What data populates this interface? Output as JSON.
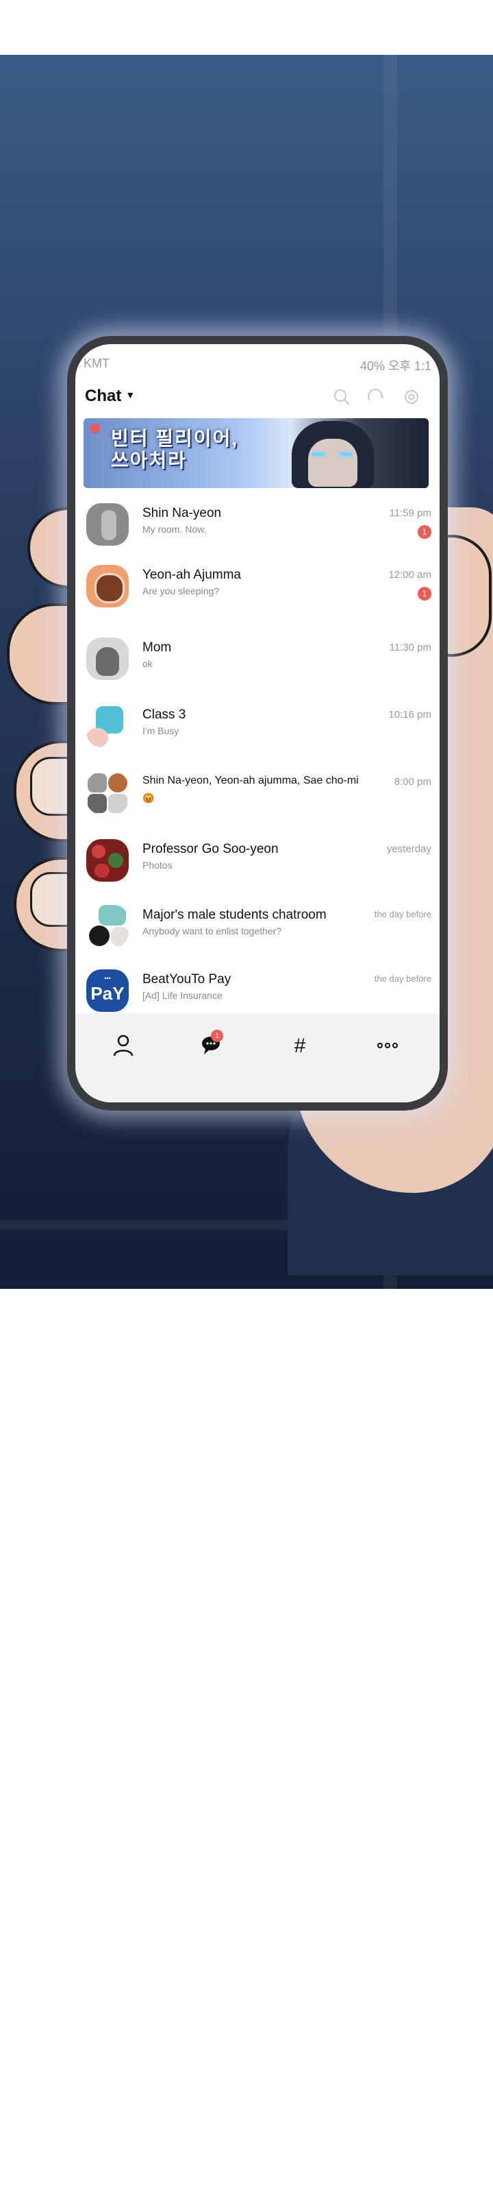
{
  "statusbar": {
    "carrier": "KMT",
    "right": "40% 오후 1:1"
  },
  "header": {
    "title": "Chat"
  },
  "banner": {
    "line1": "빈터 필리이어,",
    "line2": "쓰아처라"
  },
  "chats": [
    {
      "name": "Shin Na-yeon",
      "message": "My room. Now.",
      "time": "11:59 pm",
      "unread": "1"
    },
    {
      "name": "Yeon-ah Ajumma",
      "message": "Are you sleeping?",
      "time": "12:00 am",
      "unread": "1"
    },
    {
      "name": "Mom",
      "message": "ok",
      "time": "11:30 pm",
      "unread": ""
    },
    {
      "name": "Class 3",
      "message": "I'm Busy",
      "time": "10:16 pm",
      "unread": ""
    },
    {
      "name": "Shin Na-yeon, Yeon-ah ajumma, Sae cho-mi",
      "message": "😡",
      "time": "8:00 pm",
      "unread": ""
    },
    {
      "name": "Professor Go Soo-yeon",
      "message": "Photos",
      "time": "yesterday",
      "unread": ""
    },
    {
      "name": "Major's male students chatroom",
      "message": "Anybody want to enlist together?",
      "time": "the day before",
      "unread": ""
    },
    {
      "name": "BeatYouTo Pay",
      "message": "[Ad] Life Insurance",
      "time": "the day before",
      "unread": ""
    }
  ],
  "pay_logo": {
    "small": "•••",
    "big": "PaY"
  },
  "navbar": {
    "items": [
      {
        "icon": "person-icon",
        "badge": ""
      },
      {
        "icon": "chat-bubble-icon",
        "badge": "1"
      },
      {
        "icon": "hashtag-icon",
        "badge": ""
      },
      {
        "icon": "more-icon",
        "badge": ""
      }
    ]
  },
  "colors": {
    "badge": "#f05a50",
    "background": "#ffffff"
  }
}
